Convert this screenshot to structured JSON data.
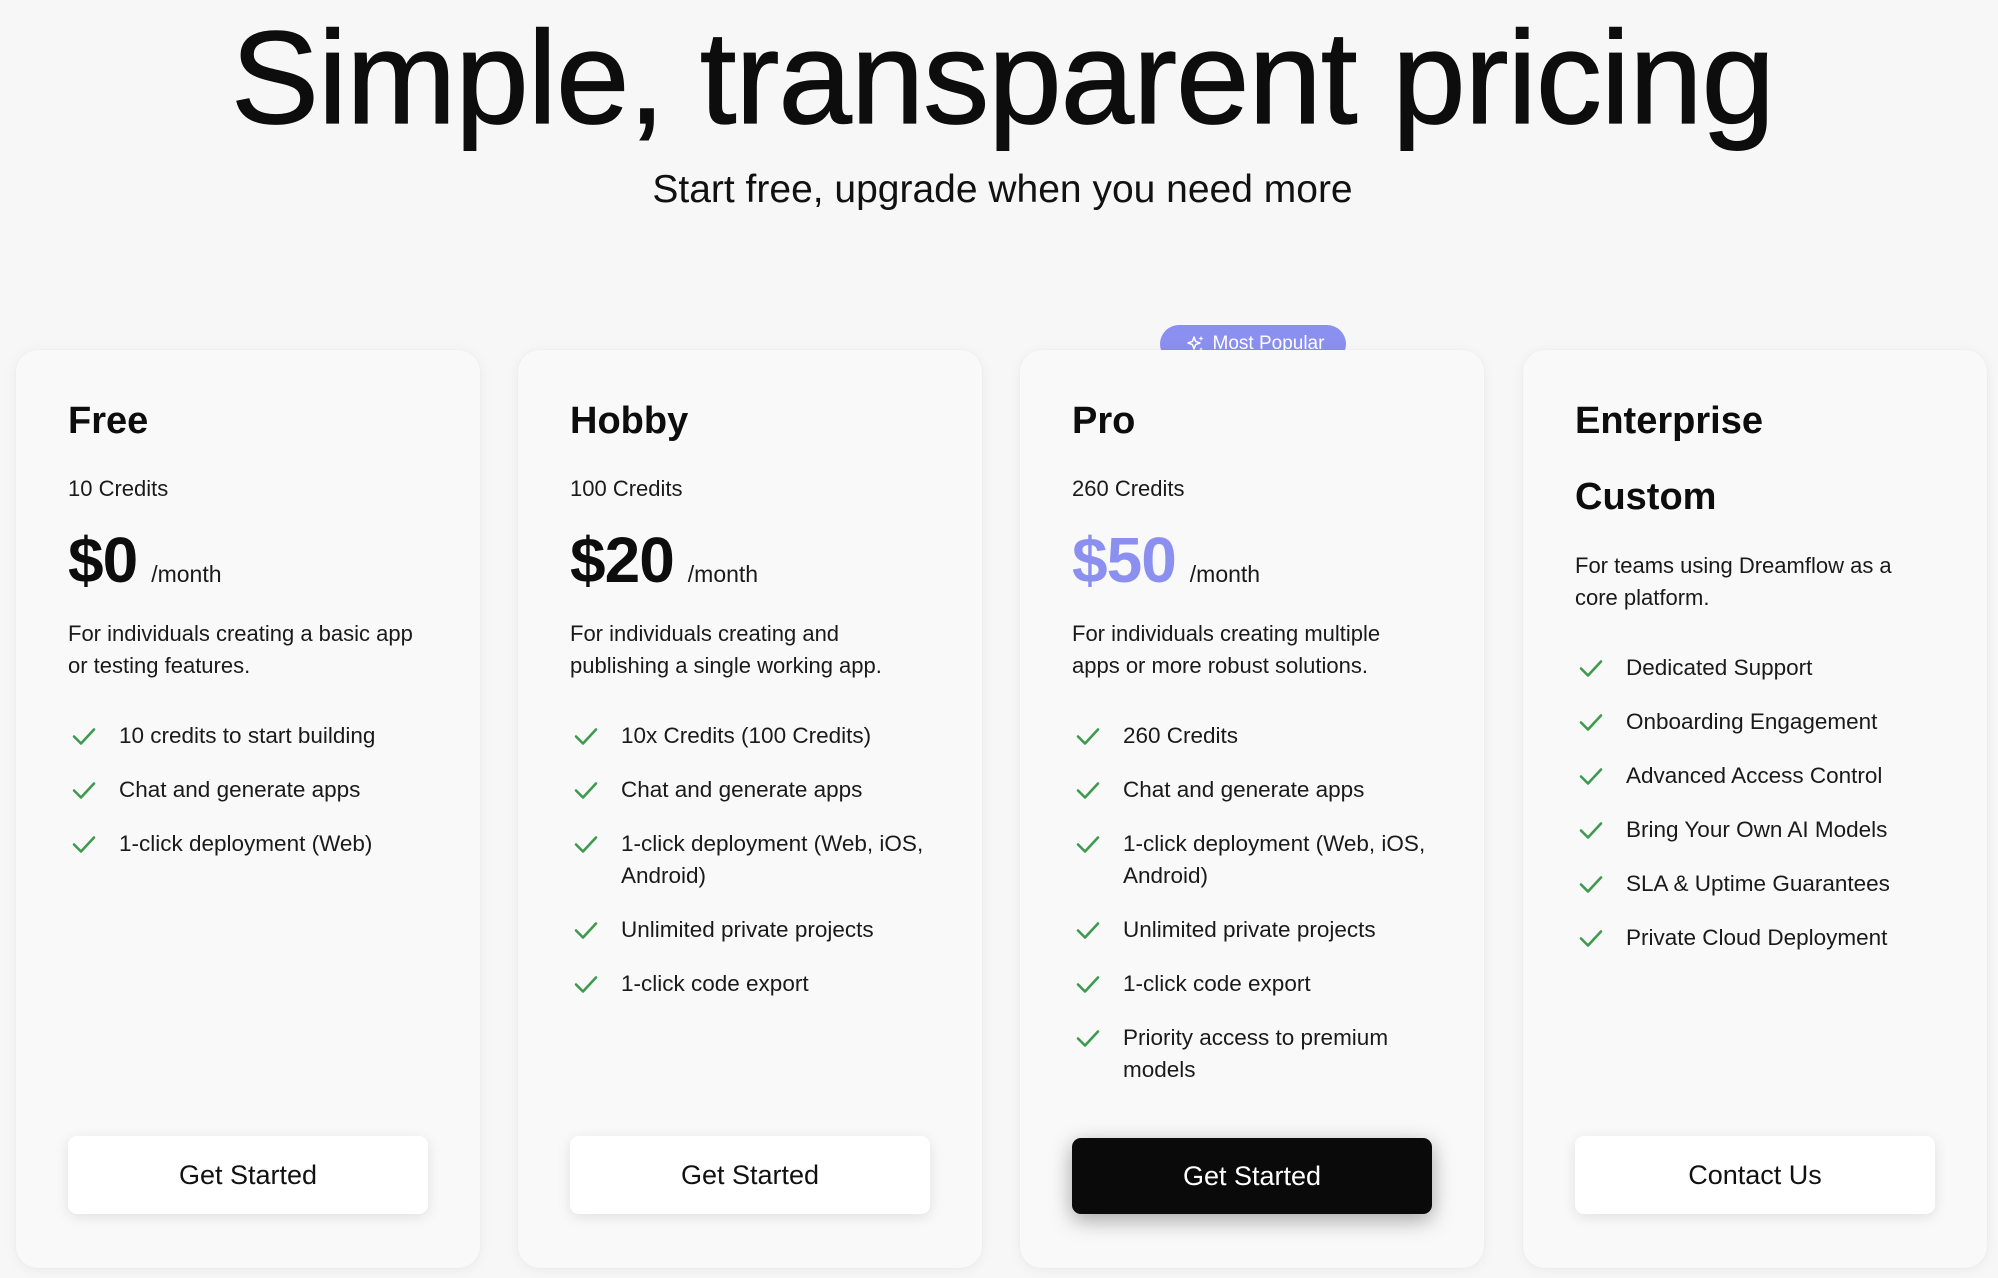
{
  "hero": {
    "title": "Simple, transparent pricing",
    "subtitle": "Start free, upgrade when you need more"
  },
  "colors": {
    "accent": "#8b8ff0",
    "check": "#3e9a4f",
    "primary_button": "#0a0a0a"
  },
  "badge": {
    "label": "Most Popular",
    "icon": "sparkle-icon"
  },
  "plans": [
    {
      "name": "Free",
      "credits": "10 Credits",
      "price": "$0",
      "period": "/month",
      "description": "For individuals creating a basic app or testing features.",
      "features": [
        "10 credits to start building",
        "Chat and generate apps",
        "1-click deployment (Web)"
      ],
      "cta": "Get Started"
    },
    {
      "name": "Hobby",
      "credits": "100 Credits",
      "price": "$20",
      "period": "/month",
      "description": "For individuals creating and publishing a single working app.",
      "features": [
        "10x Credits (100 Credits)",
        "Chat and generate apps",
        "1-click deployment (Web, iOS, Android)",
        "Unlimited private projects",
        "1-click code export"
      ],
      "cta": "Get Started"
    },
    {
      "name": "Pro",
      "credits": "260 Credits",
      "price": "$50",
      "period": "/month",
      "description": "For individuals creating multiple apps or more robust solutions.",
      "features": [
        "260 Credits",
        "Chat and generate apps",
        "1-click deployment (Web, iOS, Android)",
        "Unlimited private projects",
        "1-click code export",
        "Priority access to premium models"
      ],
      "cta": "Get Started"
    },
    {
      "name": "Enterprise",
      "price_label": "Custom",
      "description": "For teams using Dreamflow as a core platform.",
      "features": [
        "Dedicated Support",
        "Onboarding Engagement",
        "Advanced Access Control",
        "Bring Your Own AI Models",
        "SLA & Uptime Guarantees",
        "Private Cloud Deployment"
      ],
      "cta": "Contact Us"
    }
  ]
}
